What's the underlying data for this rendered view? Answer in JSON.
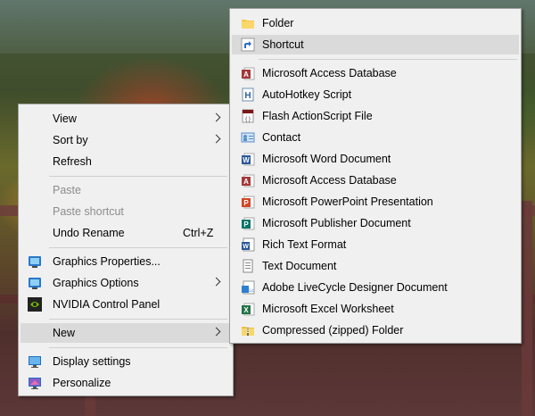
{
  "context_menu": {
    "items": [
      {
        "label": "View",
        "has_submenu": true
      },
      {
        "label": "Sort by",
        "has_submenu": true
      },
      {
        "label": "Refresh"
      },
      {
        "label": "Paste",
        "disabled": true
      },
      {
        "label": "Paste shortcut",
        "disabled": true
      },
      {
        "label": "Undo Rename",
        "shortcut": "Ctrl+Z"
      },
      {
        "label": "Graphics Properties...",
        "icon": "intel-graphics-icon"
      },
      {
        "label": "Graphics Options",
        "icon": "intel-graphics-icon",
        "has_submenu": true
      },
      {
        "label": "NVIDIA Control Panel",
        "icon": "nvidia-icon"
      },
      {
        "label": "New",
        "has_submenu": true,
        "highlighted": true
      },
      {
        "label": "Display settings",
        "icon": "display-monitor-icon"
      },
      {
        "label": "Personalize",
        "icon": "personalize-monitor-icon"
      }
    ]
  },
  "new_submenu": {
    "items": [
      {
        "label": "Folder",
        "icon": "folder-icon"
      },
      {
        "label": "Shortcut",
        "icon": "shortcut-arrow-icon",
        "highlighted": true
      },
      {
        "label": "Microsoft Access Database",
        "icon": "access-icon"
      },
      {
        "label": "AutoHotkey Script",
        "icon": "autohotkey-icon"
      },
      {
        "label": "Flash ActionScript File",
        "icon": "actionscript-file-icon"
      },
      {
        "label": "Contact",
        "icon": "contact-icon"
      },
      {
        "label": "Microsoft Word Document",
        "icon": "word-icon"
      },
      {
        "label": "Microsoft Access Database",
        "icon": "access-icon"
      },
      {
        "label": "Microsoft PowerPoint Presentation",
        "icon": "powerpoint-icon"
      },
      {
        "label": "Microsoft Publisher Document",
        "icon": "publisher-icon"
      },
      {
        "label": "Rich Text Format",
        "icon": "rtf-icon"
      },
      {
        "label": "Text Document",
        "icon": "text-document-icon"
      },
      {
        "label": "Adobe LiveCycle Designer Document",
        "icon": "livecycle-icon"
      },
      {
        "label": "Microsoft Excel Worksheet",
        "icon": "excel-icon"
      },
      {
        "label": "Compressed (zipped) Folder",
        "icon": "zip-folder-icon"
      }
    ]
  },
  "colors": {
    "menu_bg": "#f0f0f0",
    "highlight": "#dadada",
    "disabled_text": "#8c8c8c",
    "access": "#a4373a",
    "word": "#2b579a",
    "powerpoint": "#d24726",
    "publisher": "#077568",
    "excel": "#217346"
  }
}
